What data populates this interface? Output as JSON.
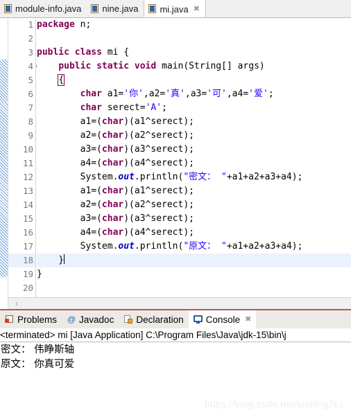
{
  "window": {
    "app": "Eclipse IDE",
    "watermark": "https://blog.csdn.net/smilingZLL"
  },
  "editor_tabs": [
    {
      "label": "module-info.java",
      "icon": "java-file-icon",
      "active": false,
      "closable": false
    },
    {
      "label": "nine.java",
      "icon": "java-file-icon",
      "active": false,
      "closable": false
    },
    {
      "label": "mi.java",
      "icon": "java-file-icon",
      "active": true,
      "closable": true,
      "close_glyph": "✖"
    }
  ],
  "editor": {
    "highlighted_line": 18,
    "folding_marker_line": 4,
    "line_numbers": [
      1,
      2,
      3,
      4,
      5,
      6,
      7,
      8,
      9,
      10,
      11,
      12,
      13,
      14,
      15,
      16,
      17,
      18,
      19,
      20
    ],
    "lines": [
      {
        "n": 1,
        "tokens": [
          {
            "t": "kw",
            "v": "package"
          },
          {
            "t": "pln",
            "v": " n;"
          }
        ]
      },
      {
        "n": 2,
        "tokens": []
      },
      {
        "n": 3,
        "tokens": [
          {
            "t": "kw",
            "v": "public class"
          },
          {
            "t": "pln",
            "v": " mi {"
          }
        ]
      },
      {
        "n": 4,
        "tokens": [
          {
            "t": "pln",
            "v": "    "
          },
          {
            "t": "kw",
            "v": "public static void"
          },
          {
            "t": "pln",
            "v": " main(String[] args)"
          }
        ]
      },
      {
        "n": 5,
        "tokens": [
          {
            "t": "pln",
            "v": "    "
          },
          {
            "t": "brk",
            "v": "{"
          }
        ]
      },
      {
        "n": 6,
        "tokens": [
          {
            "t": "pln",
            "v": "        "
          },
          {
            "t": "kw",
            "v": "char"
          },
          {
            "t": "pln",
            "v": " a1="
          },
          {
            "t": "str",
            "v": "'你'"
          },
          {
            "t": "pln",
            "v": ",a2="
          },
          {
            "t": "str",
            "v": "'真'"
          },
          {
            "t": "pln",
            "v": ",a3="
          },
          {
            "t": "str",
            "v": "'可'"
          },
          {
            "t": "pln",
            "v": ",a4="
          },
          {
            "t": "str",
            "v": "'爱'"
          },
          {
            "t": "pln",
            "v": ";"
          }
        ]
      },
      {
        "n": 7,
        "tokens": [
          {
            "t": "pln",
            "v": "        "
          },
          {
            "t": "kw",
            "v": "char"
          },
          {
            "t": "pln",
            "v": " serect="
          },
          {
            "t": "str",
            "v": "'A'"
          },
          {
            "t": "pln",
            "v": ";"
          }
        ]
      },
      {
        "n": 8,
        "tokens": [
          {
            "t": "pln",
            "v": "        a1=("
          },
          {
            "t": "kw",
            "v": "char"
          },
          {
            "t": "pln",
            "v": ")(a1^serect);"
          }
        ]
      },
      {
        "n": 9,
        "tokens": [
          {
            "t": "pln",
            "v": "        a2=("
          },
          {
            "t": "kw",
            "v": "char"
          },
          {
            "t": "pln",
            "v": ")(a2^serect);"
          }
        ]
      },
      {
        "n": 10,
        "tokens": [
          {
            "t": "pln",
            "v": "        a3=("
          },
          {
            "t": "kw",
            "v": "char"
          },
          {
            "t": "pln",
            "v": ")(a3^serect);"
          }
        ]
      },
      {
        "n": 11,
        "tokens": [
          {
            "t": "pln",
            "v": "        a4=("
          },
          {
            "t": "kw",
            "v": "char"
          },
          {
            "t": "pln",
            "v": ")(a4^serect);"
          }
        ]
      },
      {
        "n": 12,
        "tokens": [
          {
            "t": "pln",
            "v": "        System."
          },
          {
            "t": "fld",
            "v": "out"
          },
          {
            "t": "pln",
            "v": ".println("
          },
          {
            "t": "str",
            "v": "\"密文： \""
          },
          {
            "t": "pln",
            "v": "+a1+a2+a3+a4);"
          }
        ]
      },
      {
        "n": 13,
        "tokens": [
          {
            "t": "pln",
            "v": "        a1=("
          },
          {
            "t": "kw",
            "v": "char"
          },
          {
            "t": "pln",
            "v": ")(a1^serect);"
          }
        ]
      },
      {
        "n": 14,
        "tokens": [
          {
            "t": "pln",
            "v": "        a2=("
          },
          {
            "t": "kw",
            "v": "char"
          },
          {
            "t": "pln",
            "v": ")(a2^serect);"
          }
        ]
      },
      {
        "n": 15,
        "tokens": [
          {
            "t": "pln",
            "v": "        a3=("
          },
          {
            "t": "kw",
            "v": "char"
          },
          {
            "t": "pln",
            "v": ")(a3^serect);"
          }
        ]
      },
      {
        "n": 16,
        "tokens": [
          {
            "t": "pln",
            "v": "        a4=("
          },
          {
            "t": "kw",
            "v": "char"
          },
          {
            "t": "pln",
            "v": ")(a4^serect);"
          }
        ]
      },
      {
        "n": 17,
        "tokens": [
          {
            "t": "pln",
            "v": "        System."
          },
          {
            "t": "fld",
            "v": "out"
          },
          {
            "t": "pln",
            "v": ".println("
          },
          {
            "t": "str",
            "v": "\"原文： \""
          },
          {
            "t": "pln",
            "v": "+a1+a2+a3+a4);"
          }
        ]
      },
      {
        "n": 18,
        "tokens": [
          {
            "t": "pln",
            "v": "    }"
          },
          {
            "t": "caret",
            "v": ""
          }
        ]
      },
      {
        "n": 19,
        "tokens": [
          {
            "t": "pln",
            "v": "}"
          }
        ]
      },
      {
        "n": 20,
        "tokens": []
      }
    ],
    "hscroll_left_arrow": "‹"
  },
  "view_tabs": [
    {
      "label": "Problems",
      "icon": "problems-icon",
      "active": false,
      "closable": false
    },
    {
      "label": "Javadoc",
      "icon": "javadoc-at-icon",
      "active": false,
      "closable": false
    },
    {
      "label": "Declaration",
      "icon": "declaration-icon",
      "active": false,
      "closable": false
    },
    {
      "label": "Console",
      "icon": "console-icon",
      "active": true,
      "closable": true,
      "close_glyph": "✖"
    }
  ],
  "console": {
    "header": "<terminated> mi [Java Application] C:\\Program Files\\Java\\jdk-15\\bin\\j",
    "output": [
      "密文： 伟睁斯轴",
      "原文： 你真可爱"
    ]
  },
  "colors": {
    "keyword": "#7f0055",
    "string": "#2a00ff",
    "field": "#0000c0",
    "line_number": "#787878",
    "current_line": "#eaf2fd",
    "console_accent": "#b05a5a"
  }
}
